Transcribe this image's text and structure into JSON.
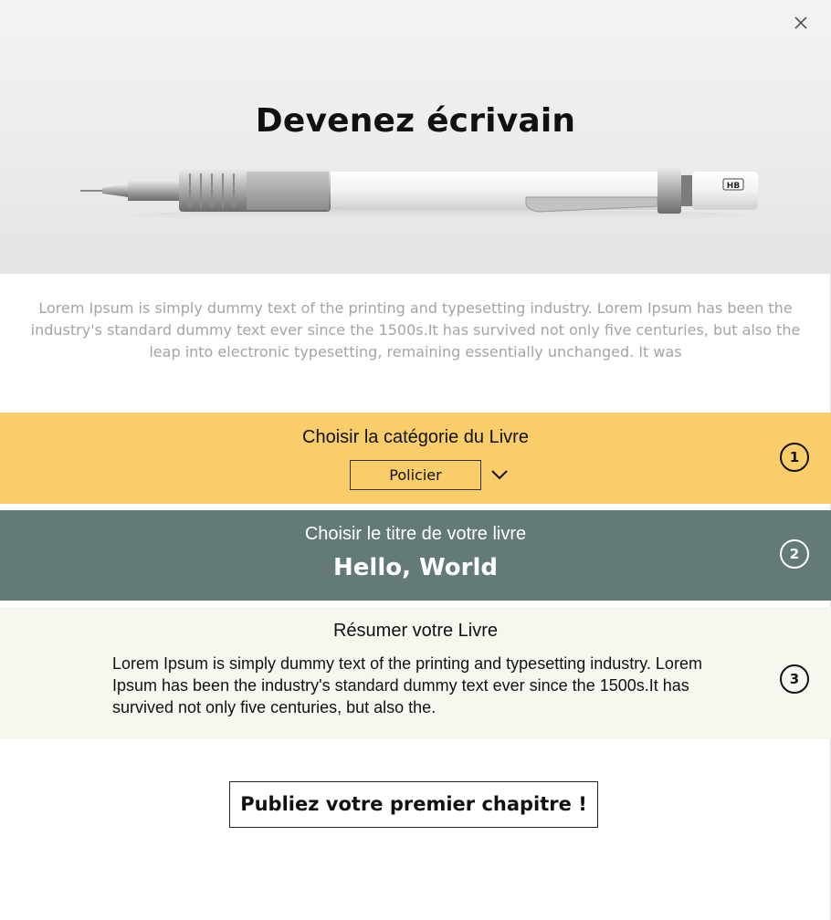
{
  "header": {
    "title": "Devenez écrivain",
    "close_icon": "close-icon",
    "pencil_label": "HB"
  },
  "intro_text": "Lorem Ipsum is simply dummy text of the printing and typesetting industry. Lorem Ipsum has been the industry's standard dummy text ever since the 1500s.It has survived not only five centuries, but also the leap into electronic typesetting, remaining essentially unchanged. It was",
  "steps": [
    {
      "number": "1",
      "label": "Choisir la catégorie du Livre",
      "selected_category": "Policier",
      "dropdown_icon": "chevron-down-icon",
      "color": "#f9cd69"
    },
    {
      "number": "2",
      "label": "Choisir le titre de votre livre",
      "book_title": "Hello, World",
      "color": "#637a78"
    },
    {
      "number": "3",
      "label": "Résumer votre Livre",
      "summary": "Lorem Ipsum is simply dummy text of the printing and typesetting industry. Lorem Ipsum has been the industry's standard dummy text ever since the 1500s.It has survived not only five centuries, but also the.",
      "color": "#f8f7ef"
    }
  ],
  "cta": {
    "label": "Publiez votre premier chapitre !"
  }
}
